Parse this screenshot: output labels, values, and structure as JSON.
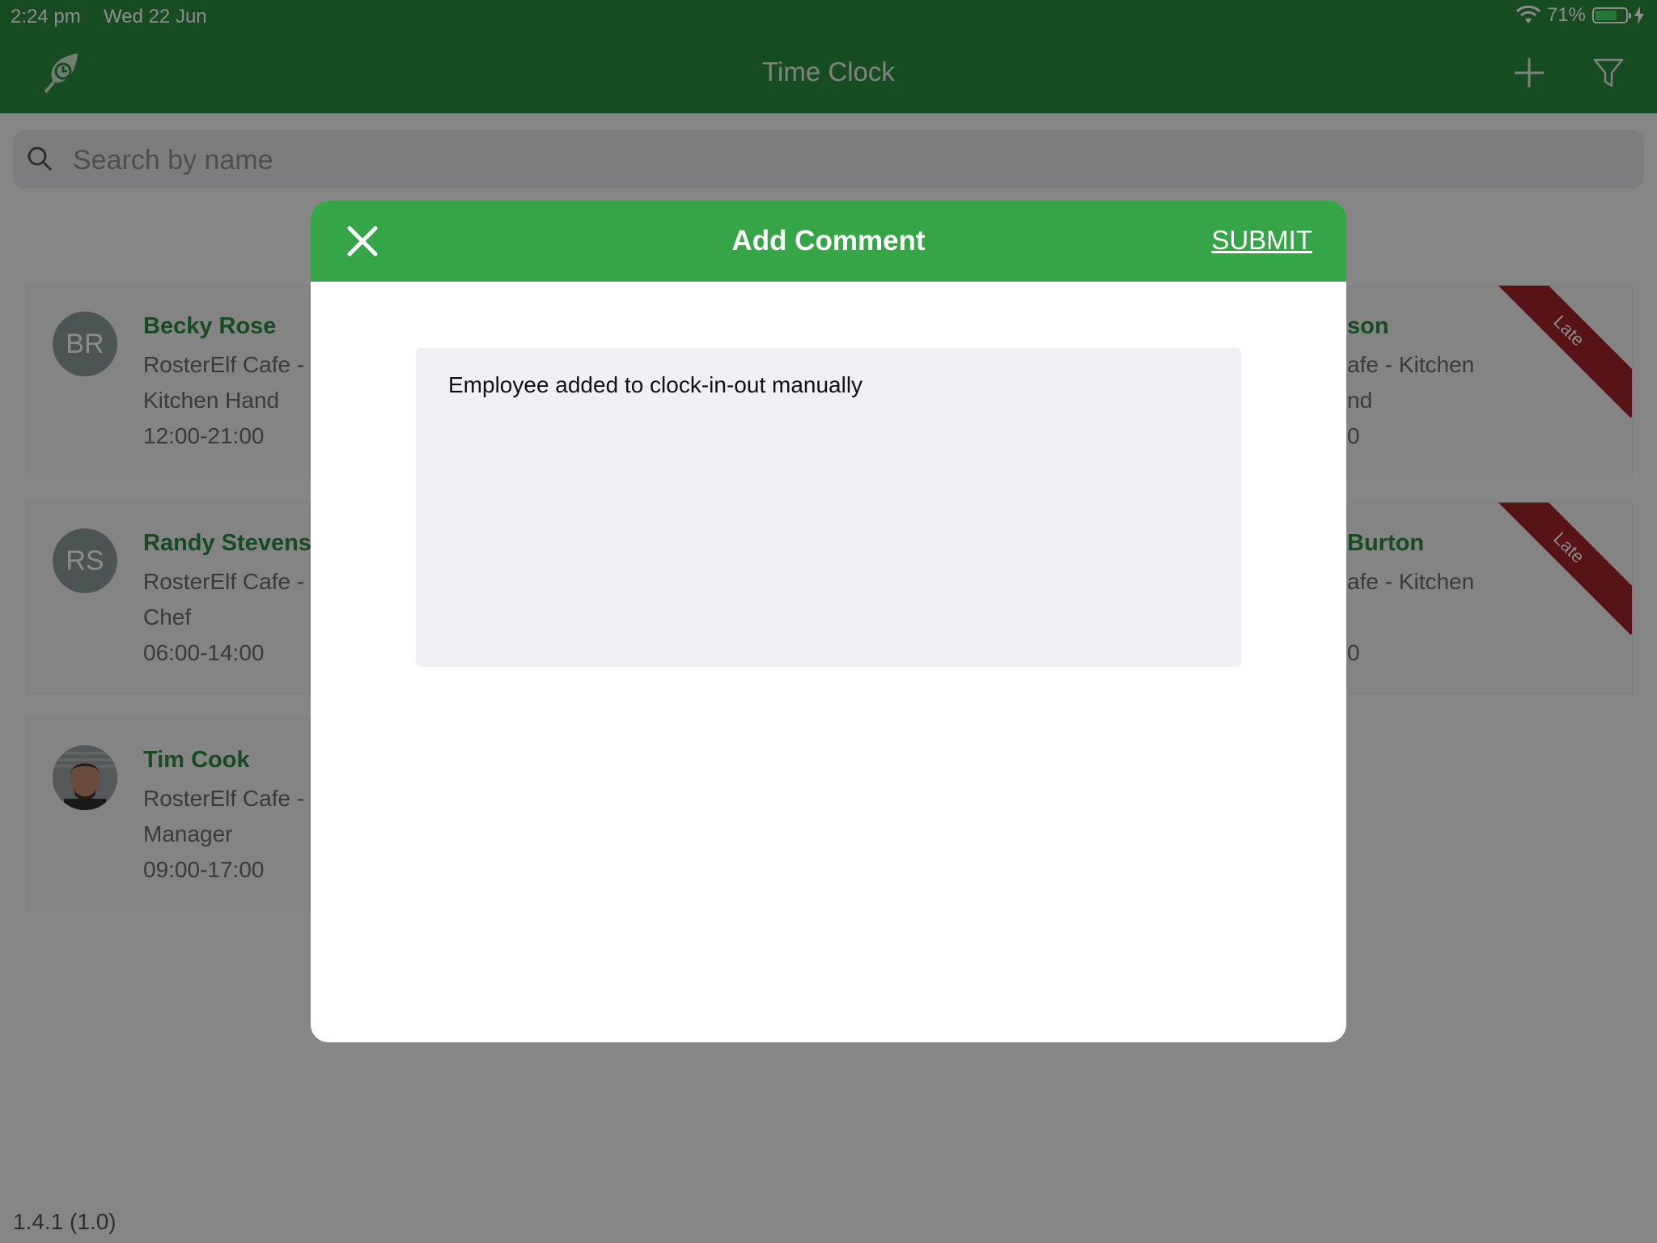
{
  "status_bar": {
    "time": "2:24 pm",
    "date": "Wed 22 Jun",
    "battery": "71%",
    "battery_level": 0.71,
    "wifi_icon": "wifi-icon",
    "charging_icon": "bolt-icon"
  },
  "nav": {
    "title": "Time Clock",
    "logo_icon": "clock-leaf-icon",
    "add_icon": "plus-icon",
    "filter_icon": "filter-icon"
  },
  "search": {
    "placeholder": "Search by name",
    "icon": "search-icon"
  },
  "employees_left": [
    {
      "initials": "BR",
      "name": "Becky Rose",
      "location": "RosterElf Cafe -",
      "role": "Kitchen Hand",
      "hours": "12:00-21:00"
    },
    {
      "initials": "RS",
      "name": "Randy Stevens",
      "location": "RosterElf Cafe -",
      "role": "Chef",
      "hours": "06:00-14:00"
    },
    {
      "initials": "",
      "name": "Tim Cook",
      "location": "RosterElf Cafe -",
      "role": "Manager",
      "hours": "09:00-17:00",
      "avatar": "photo"
    }
  ],
  "employees_right": [
    {
      "name": "son",
      "location": "afe - Kitchen",
      "role": "nd",
      "hours": "0",
      "badge": "Late"
    },
    {
      "name": "Burton",
      "location": "afe - Kitchen",
      "role": "",
      "hours": "0",
      "badge": "Late"
    }
  ],
  "version": "1.4.1 (1.0)",
  "modal": {
    "title": "Add Comment",
    "submit_label": "SUBMIT",
    "close_icon": "close-icon",
    "comment": "Employee added to clock-in-out manually"
  },
  "colors": {
    "brand_green": "#2b8a3e",
    "modal_header_green": "#36a548",
    "late_red": "#a0242a"
  }
}
